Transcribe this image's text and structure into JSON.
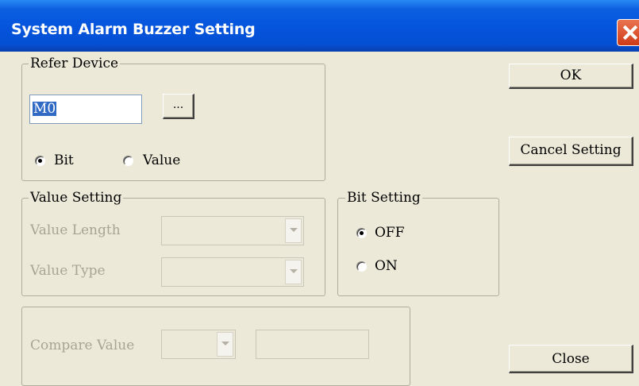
{
  "window": {
    "title": "System Alarm Buzzer Setting"
  },
  "refer_device": {
    "legend": "Refer Device",
    "device_value": "M0",
    "browse_label": "...",
    "radio_bit_label": "Bit",
    "radio_value_label": "Value",
    "selected": "Bit"
  },
  "value_setting": {
    "legend": "Value Setting",
    "length_label": "Value Length",
    "length_value": "",
    "type_label": "Value Type",
    "type_value": ""
  },
  "bit_setting": {
    "legend": "Bit Setting",
    "off_label": "OFF",
    "on_label": "ON",
    "selected": "OFF"
  },
  "compare": {
    "label": "Compare Value",
    "operator_value": "",
    "value": ""
  },
  "buttons": {
    "ok": "OK",
    "cancel": "Cancel Setting",
    "close": "Close"
  }
}
